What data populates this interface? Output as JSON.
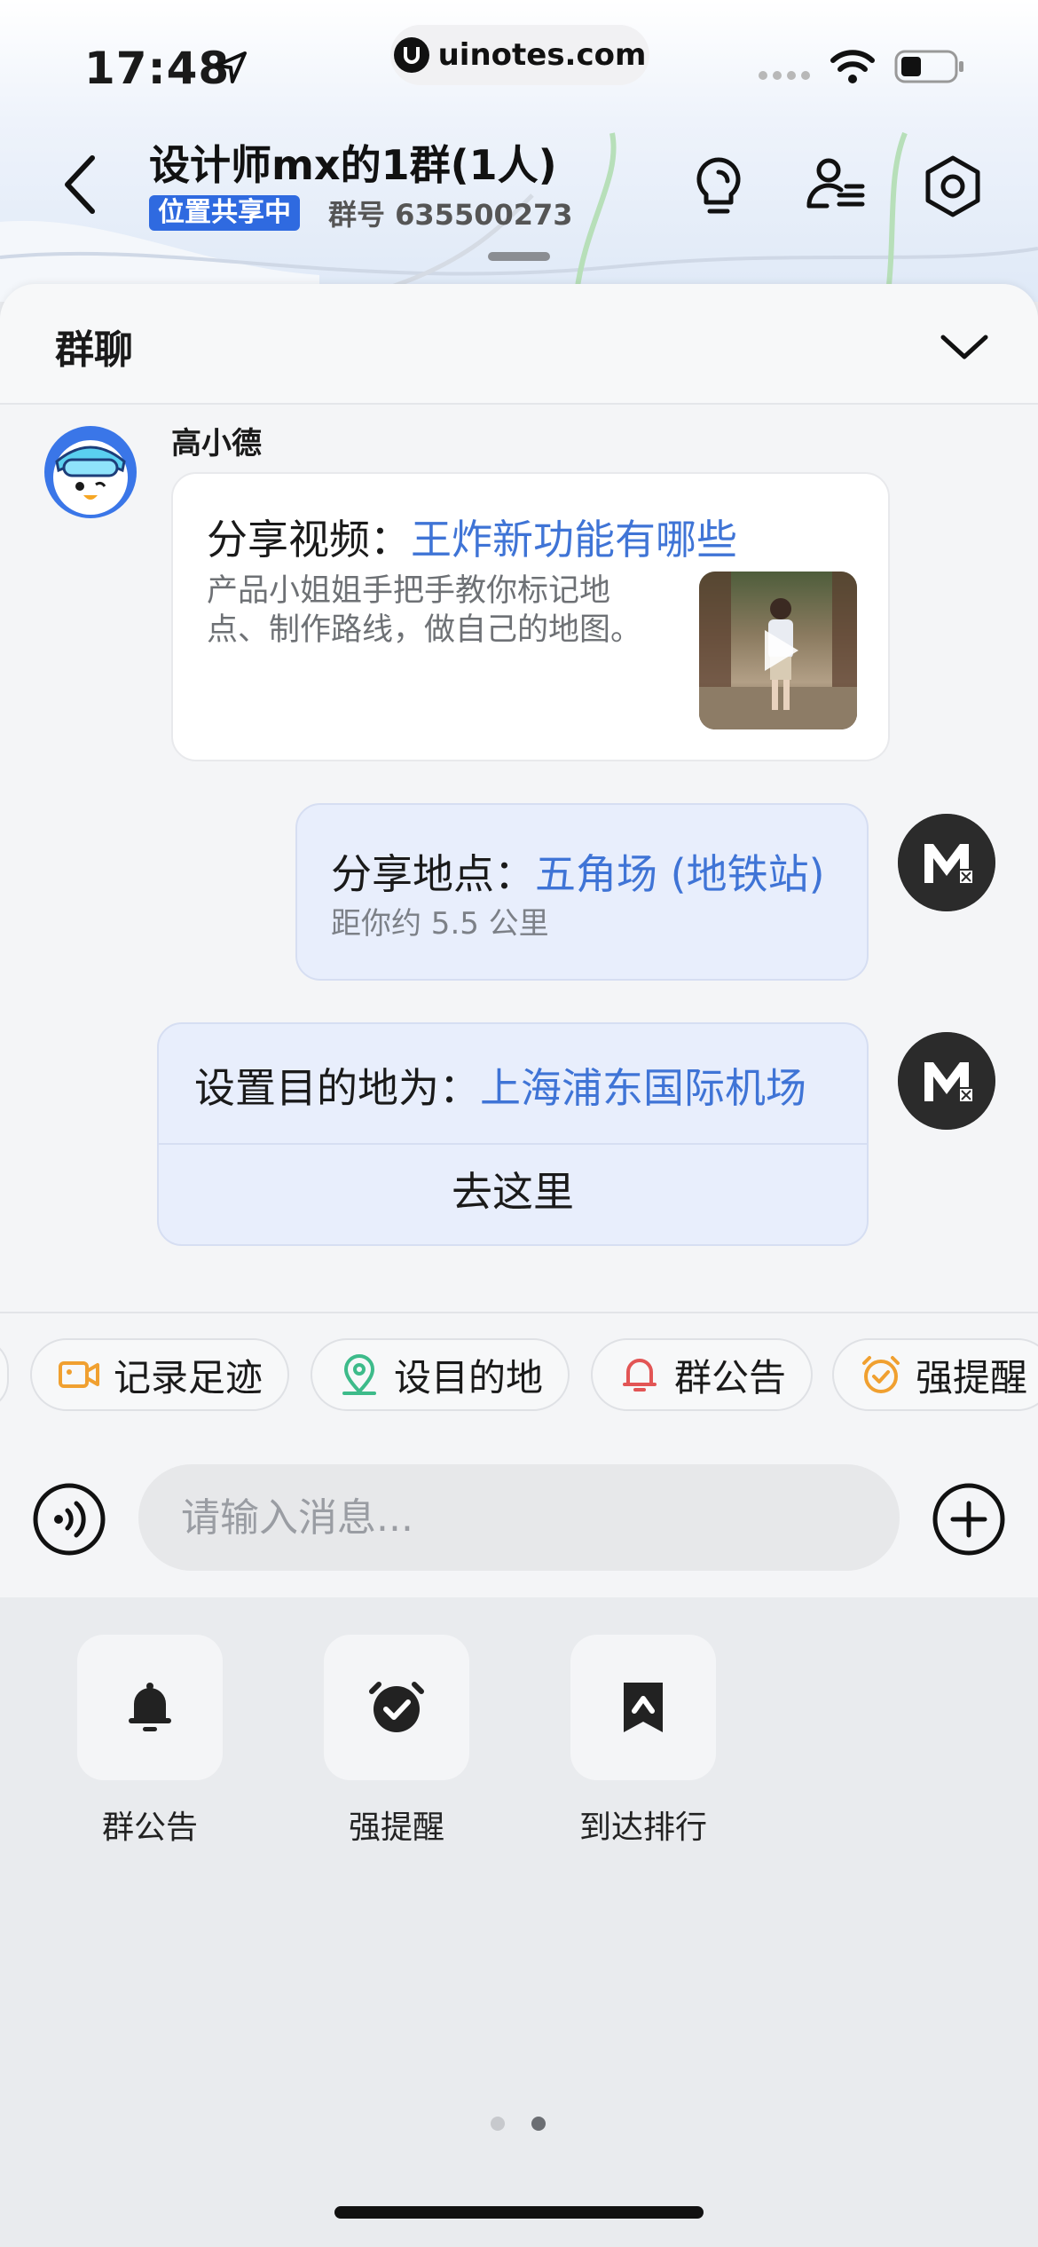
{
  "status_bar": {
    "time": "17:48",
    "url": "uinotes.com"
  },
  "header": {
    "title": "设计师mx的1群(1人)",
    "location_badge": "位置共享中",
    "group_number": "群号 635500273"
  },
  "chat": {
    "panel_title": "群聊",
    "messages": [
      {
        "sender": "高小德",
        "prefix": "分享视频：",
        "link": "王炸新功能有哪些",
        "description": "产品小姐姐手把手教你标记地点、制作路线，做自己的地图。"
      },
      {
        "prefix": "分享地点：",
        "link": "五角场 (地铁站)",
        "detail": "距你约 5.5 公里"
      },
      {
        "prefix": "设置目的地为：",
        "link": "上海浦东国际机场",
        "action": "去这里"
      }
    ]
  },
  "quick_actions": [
    {
      "label": "记录足迹",
      "icon": "video-camera-icon",
      "color": "#f0a030"
    },
    {
      "label": "设目的地",
      "icon": "location-pin-icon",
      "color": "#3dbb8a"
    },
    {
      "label": "群公告",
      "icon": "bell-icon",
      "color": "#e25555"
    },
    {
      "label": "强提醒",
      "icon": "alarm-clock-icon",
      "color": "#f0a030"
    }
  ],
  "composer": {
    "placeholder": "请输入消息..."
  },
  "tools": [
    {
      "label": "群公告",
      "icon": "bell-icon"
    },
    {
      "label": "强提醒",
      "icon": "alarm-check-icon"
    },
    {
      "label": "到达排行",
      "icon": "bookmark-up-icon"
    }
  ],
  "pager": {
    "pages": 2,
    "active": 2
  },
  "colors": {
    "accent": "#3f74d6",
    "badge": "#2f6ae0",
    "bubble": "#e8eefc"
  }
}
